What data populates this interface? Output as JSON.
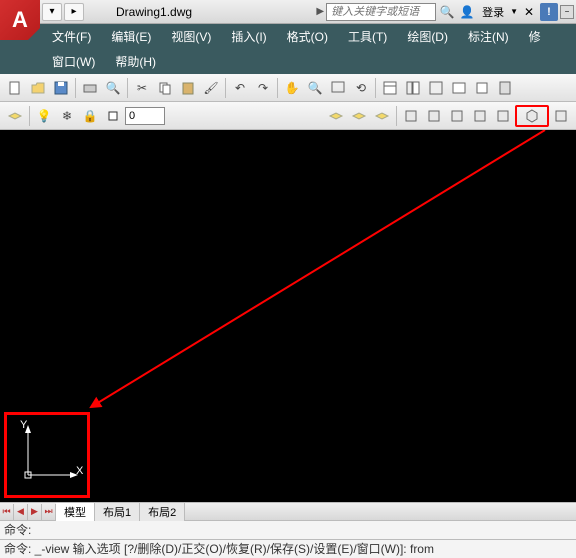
{
  "titlebar": {
    "doc_title": "Drawing1.dwg",
    "search_placeholder": "键入关键字或短语",
    "login_label": "登录",
    "help_symbol": "!"
  },
  "menu": {
    "row1": [
      "文件(F)",
      "编辑(E)",
      "视图(V)",
      "插入(I)",
      "格式(O)",
      "工具(T)",
      "绘图(D)",
      "标注(N)",
      "修"
    ],
    "row2": [
      "窗口(W)",
      "帮助(H)"
    ]
  },
  "toolbar2": {
    "layer_value": "0"
  },
  "layout": {
    "active": "模型",
    "tab1": "布局1",
    "tab2": "布局2"
  },
  "ucs": {
    "x_label": "X",
    "y_label": "Y"
  },
  "command": {
    "line1": "命令:",
    "line2_prefix": "命令: _-view 输入选项 [?/删除(D)/正交(O)/恢复(R)/保存(S)/设置(E)/窗口(W)]: from",
    "watermark": ""
  }
}
